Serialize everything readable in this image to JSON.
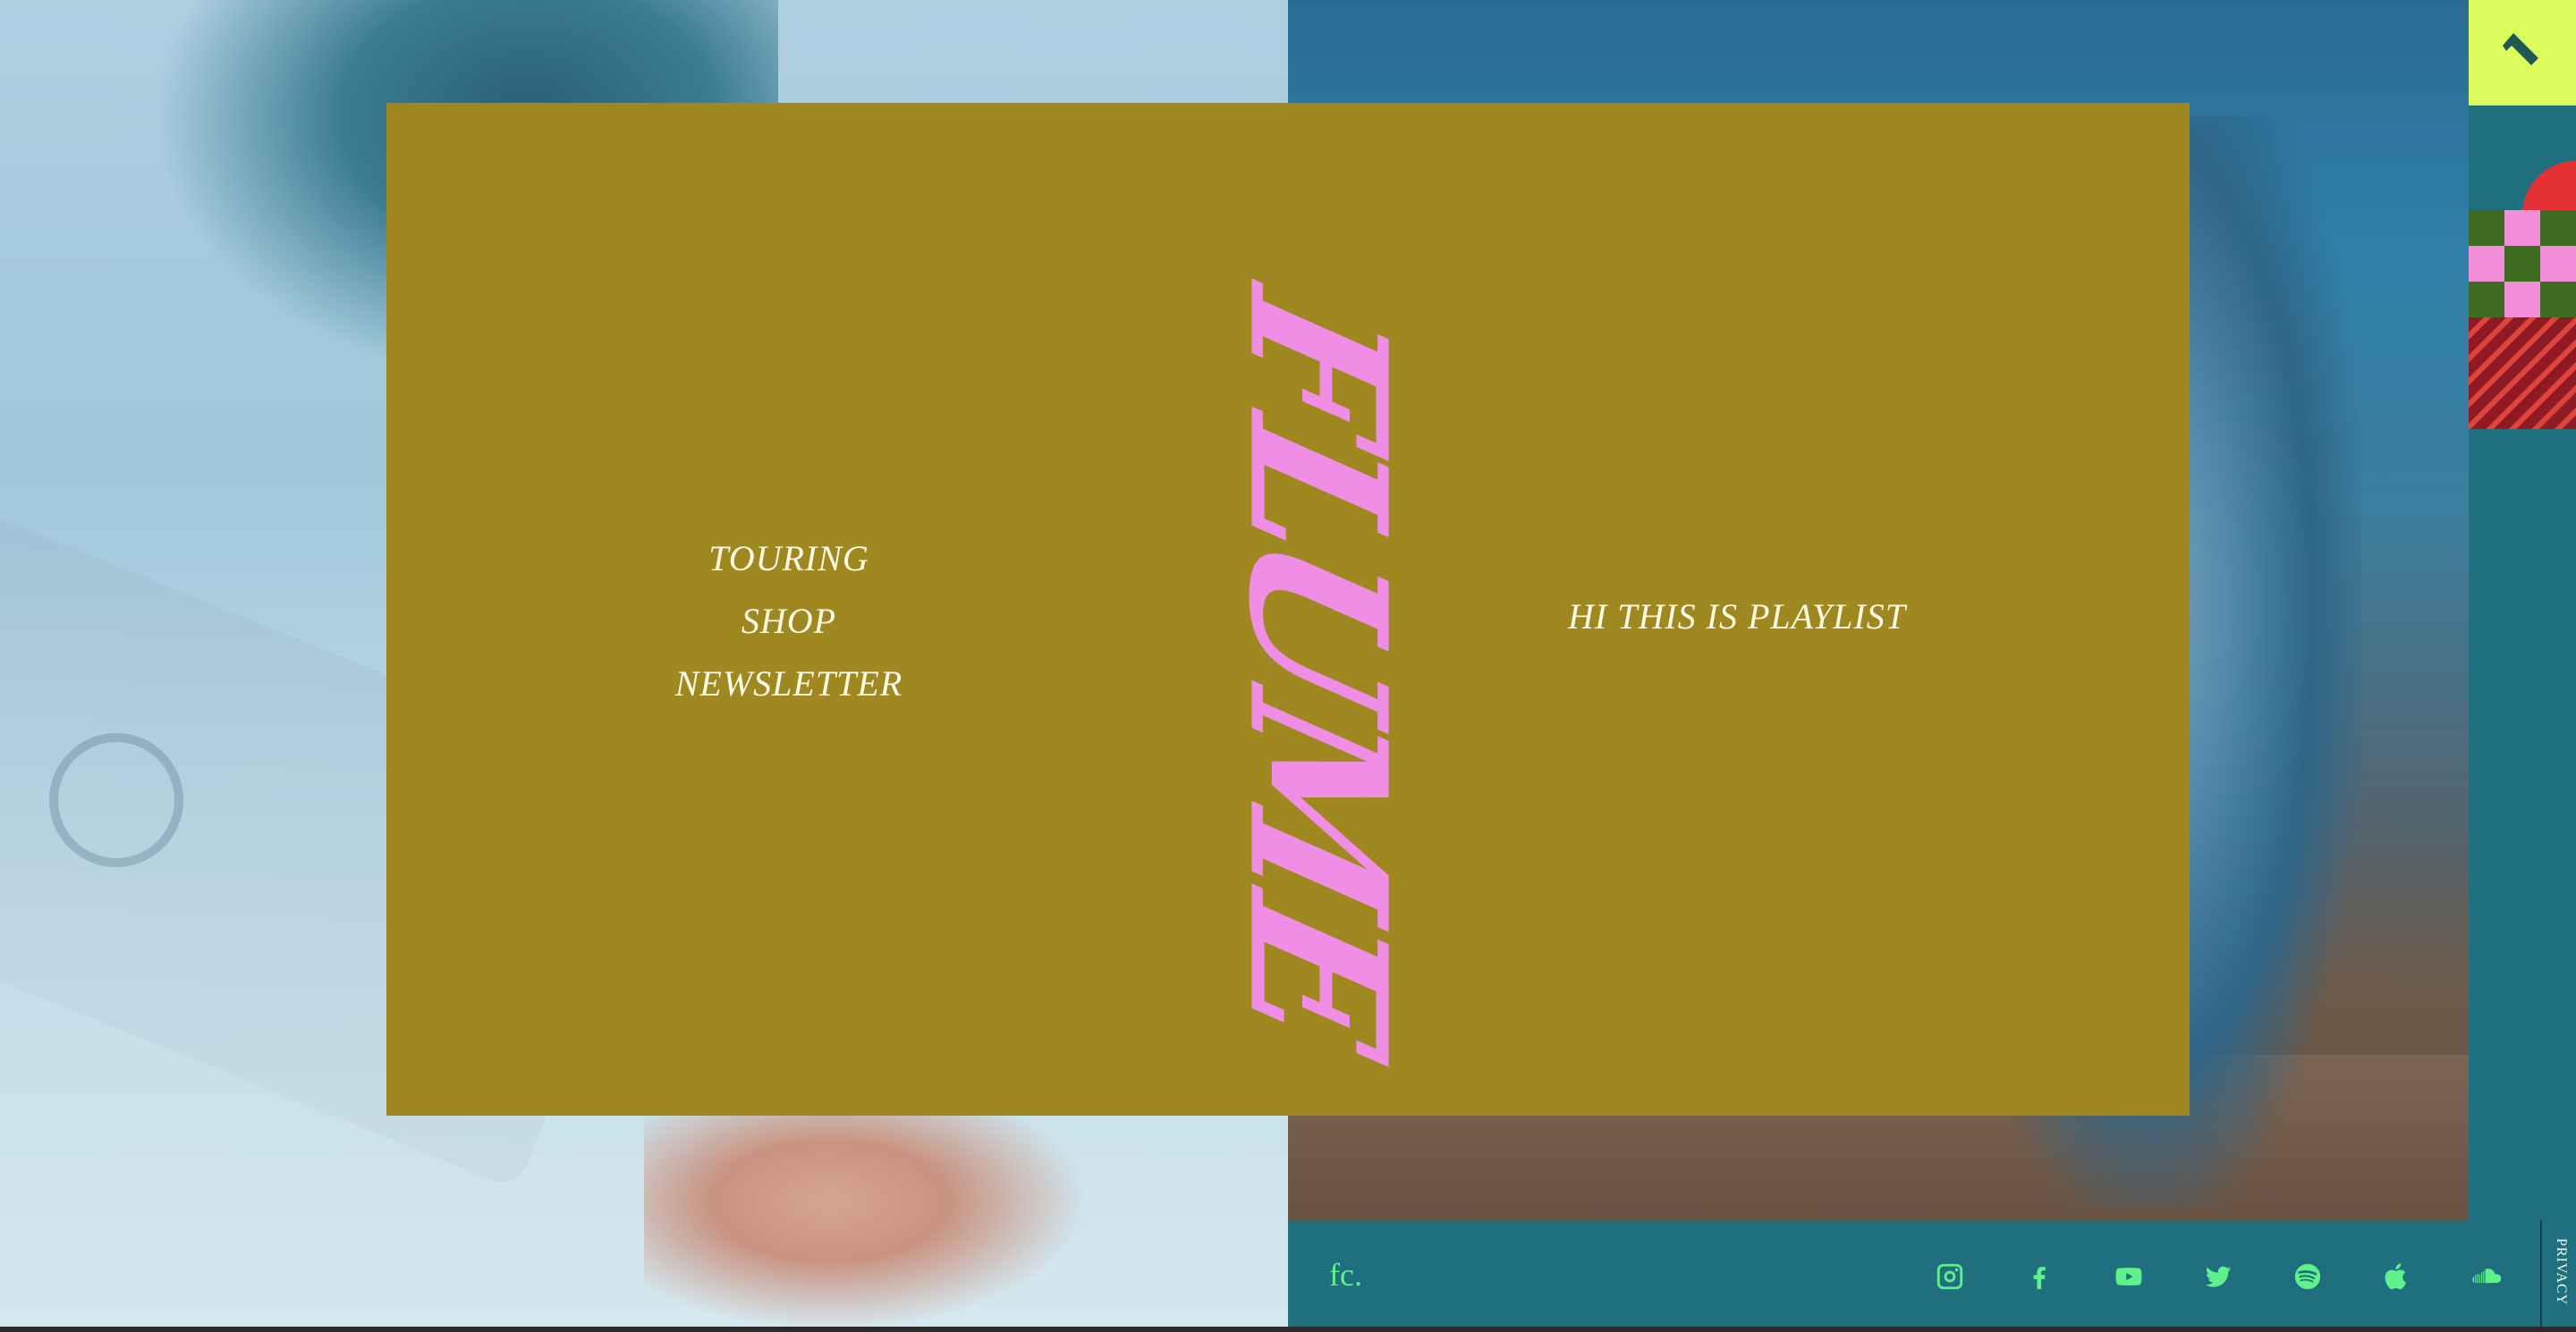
{
  "brand": {
    "logo_text": "FLUME",
    "monogram": "fc."
  },
  "nav": {
    "items": [
      {
        "label": "TOURING"
      },
      {
        "label": "SHOP"
      },
      {
        "label": "NEWSLETTER"
      }
    ]
  },
  "playlist": {
    "label": "HI THIS IS PLAYLIST"
  },
  "side": {
    "up_icon": "arrow-up-left-icon",
    "colors": {
      "up_bg": "#dcfb5c",
      "red": "#e53035",
      "pink": "#f28fd8",
      "green": "#3d6b1f",
      "maroon": "#8e1a23"
    }
  },
  "footer": {
    "socials": [
      {
        "name": "instagram-icon"
      },
      {
        "name": "facebook-icon"
      },
      {
        "name": "youtube-icon"
      },
      {
        "name": "twitter-icon"
      },
      {
        "name": "spotify-icon"
      },
      {
        "name": "apple-icon"
      },
      {
        "name": "soundcloud-icon"
      }
    ],
    "privacy_label": "PRIVACY"
  },
  "colors": {
    "panel": "#a08820",
    "logo": "#f08ee6",
    "nav_text": "#fdfbe6",
    "footer_bg": "#1f6f7e",
    "footer_icon": "#5ff28a"
  }
}
